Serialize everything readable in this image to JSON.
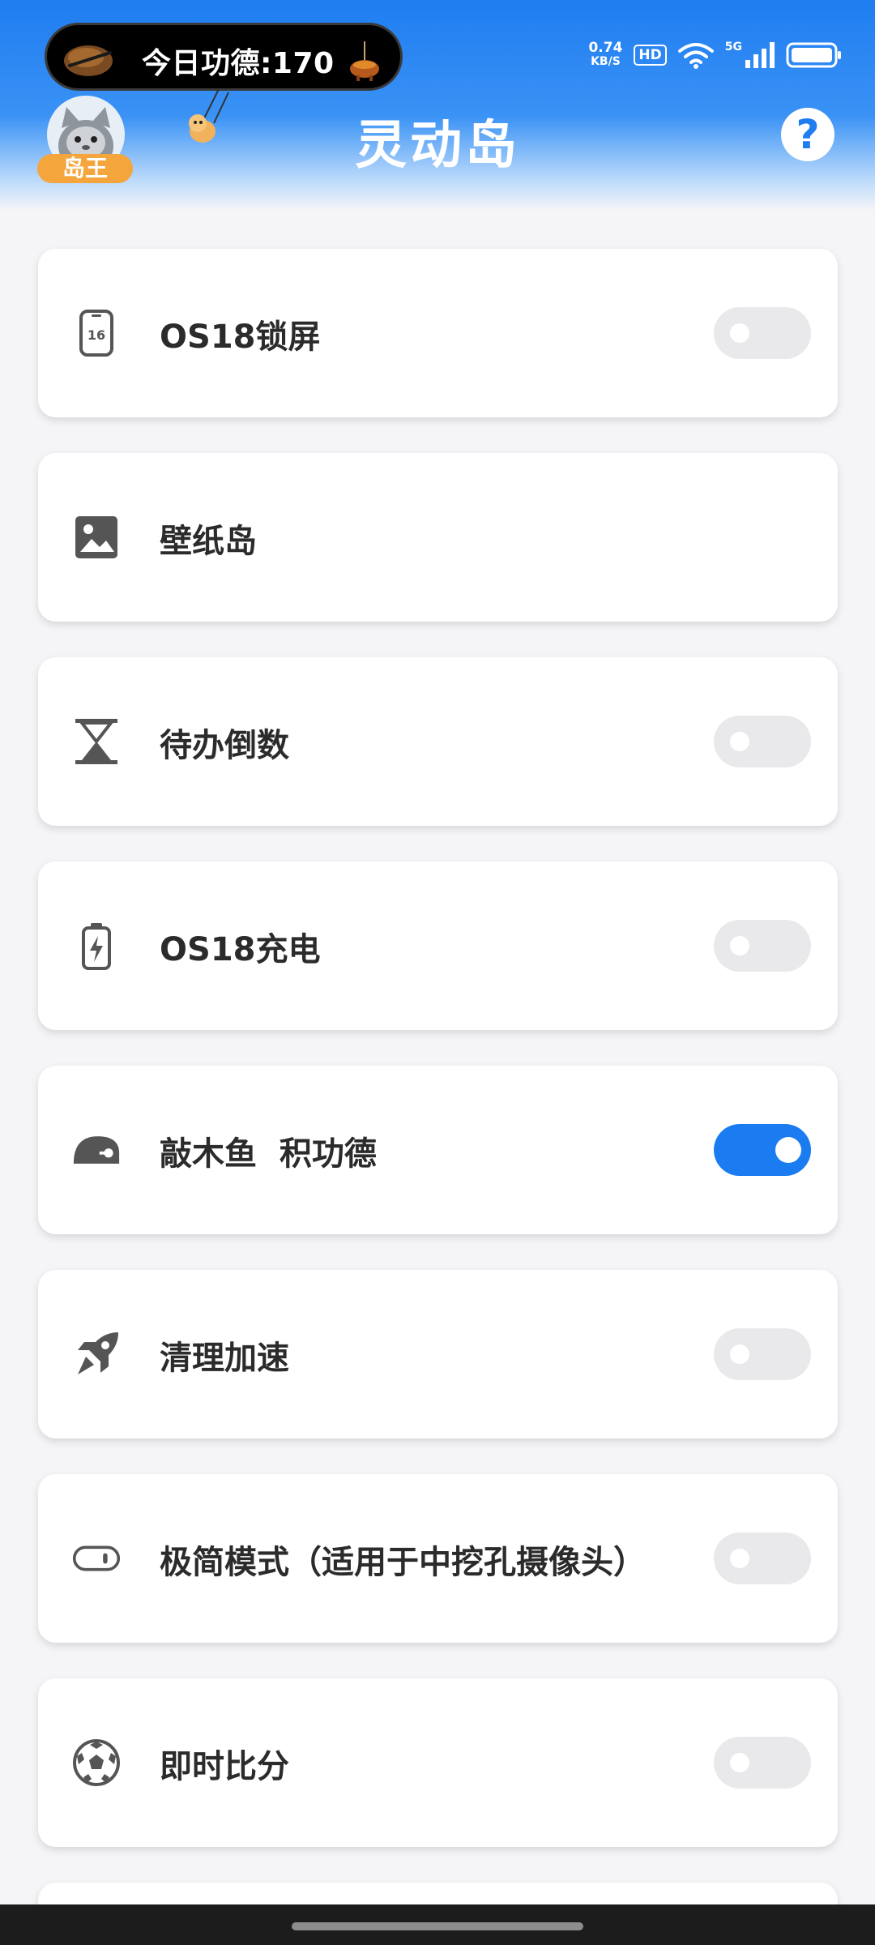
{
  "status_bar": {
    "merit_text": "今日功德:170",
    "net_speed_value": "0.74",
    "net_speed_unit": "KB/S",
    "hd_label": "HD",
    "signal_label": "5G"
  },
  "header": {
    "title": "灵动岛",
    "badge": "岛王",
    "help_symbol": "?"
  },
  "colors": {
    "accent": "#1a7cf0",
    "header_blue": "#1f7df0",
    "badge_orange": "#f4a53b"
  },
  "items": [
    {
      "label": "OS18锁屏",
      "icon": "phone-16-icon",
      "has_toggle": true,
      "on": false
    },
    {
      "label": "壁纸岛",
      "icon": "image-icon",
      "has_toggle": false
    },
    {
      "label": "待办倒数",
      "icon": "hourglass-icon",
      "has_toggle": true,
      "on": false
    },
    {
      "label": "OS18充电",
      "icon": "battery-charging-icon",
      "has_toggle": true,
      "on": false
    },
    {
      "label": "敲木鱼  积功德",
      "icon": "wooden-fish-icon",
      "has_toggle": true,
      "on": true
    },
    {
      "label": "清理加速",
      "icon": "rocket-icon",
      "has_toggle": true,
      "on": false
    },
    {
      "label": "极简模式（适用于中挖孔摄像头）",
      "icon": "pill-camera-icon",
      "has_toggle": true,
      "on": false
    },
    {
      "label": "即时比分",
      "icon": "soccer-ball-icon",
      "has_toggle": true,
      "on": false
    }
  ]
}
